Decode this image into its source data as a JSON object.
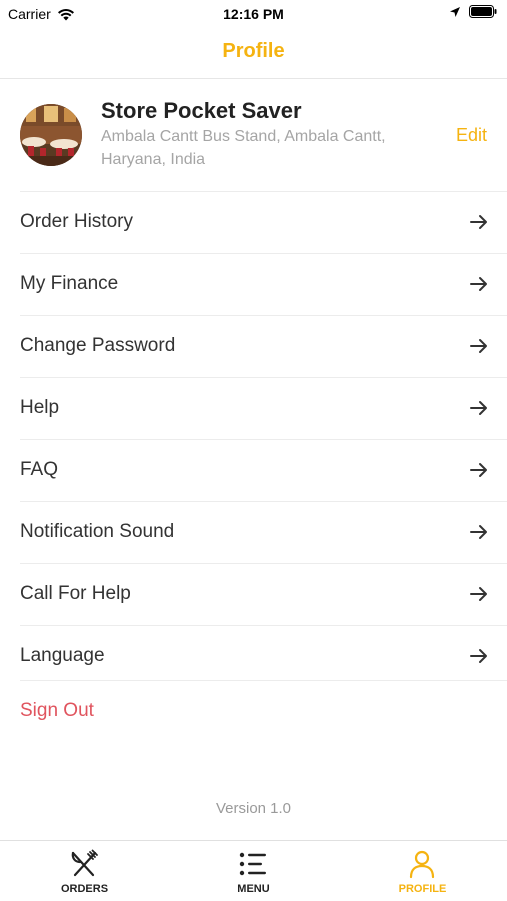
{
  "status_bar": {
    "carrier": "Carrier",
    "time": "12:16 PM"
  },
  "nav": {
    "title": "Profile"
  },
  "profile": {
    "store_name": "Store Pocket Saver",
    "address": "Ambala Cantt Bus Stand, Ambala Cantt, Haryana, India",
    "edit_label": "Edit"
  },
  "menu": {
    "items": [
      {
        "label": "Order History"
      },
      {
        "label": "My Finance"
      },
      {
        "label": "Change Password"
      },
      {
        "label": "Help"
      },
      {
        "label": "FAQ"
      },
      {
        "label": "Notification Sound"
      },
      {
        "label": "Call For Help"
      },
      {
        "label": "Language"
      }
    ],
    "sign_out_label": "Sign Out"
  },
  "footer": {
    "version": "Version 1.0"
  },
  "tabs": [
    {
      "label": "ORDERS",
      "icon": "fork-knife-icon"
    },
    {
      "label": "MENU",
      "icon": "list-icon"
    },
    {
      "label": "PROFILE",
      "icon": "person-icon",
      "active": true
    }
  ],
  "colors": {
    "accent": "#f5b311",
    "danger": "#e0545e",
    "muted": "#a5a5a5"
  }
}
